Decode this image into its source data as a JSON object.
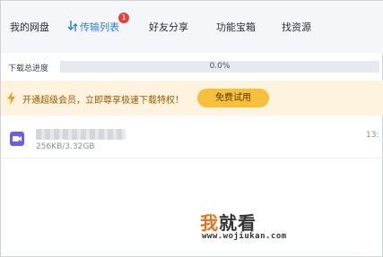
{
  "nav": {
    "tabs": [
      {
        "label": "我的网盘"
      },
      {
        "label": "传输列表",
        "badge": "1"
      },
      {
        "label": "好友分享"
      },
      {
        "label": "功能宝箱"
      },
      {
        "label": "找资源"
      }
    ],
    "active_tab": "传输列表",
    "accent_color": "#2c7fe0"
  },
  "progress": {
    "label": "下载总进度",
    "value_text": "0.0%",
    "value": 0.0
  },
  "banner": {
    "text": "开通超级会员，立即尊享极速下载特权！",
    "button_label": "免费试用",
    "icon": "lightning-icon"
  },
  "file": {
    "icon": "video-file-icon",
    "size_text": "256KB/3.32GB",
    "time_text": "13:"
  },
  "watermark": {
    "first_char": "我",
    "rest": "就看",
    "url": "www.wojiukan.com"
  }
}
